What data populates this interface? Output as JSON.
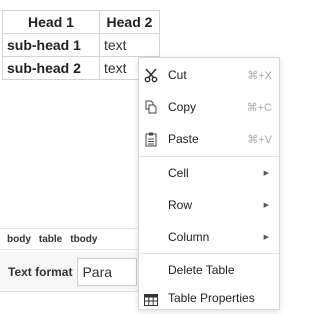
{
  "table": {
    "head1": "Head 1",
    "head2": "Head 2",
    "rows": [
      {
        "label": "sub-head 1",
        "value": "text"
      },
      {
        "label": "sub-head 2",
        "value": "text"
      }
    ]
  },
  "pathbar": {
    "items": [
      "body",
      "table",
      "tbody"
    ]
  },
  "format": {
    "label": "Text format",
    "value": "Para"
  },
  "context_menu": {
    "cut": {
      "label": "Cut",
      "shortcut": "⌘+X",
      "icon": "scissors-icon"
    },
    "copy": {
      "label": "Copy",
      "shortcut": "⌘+C",
      "icon": "copy-icon"
    },
    "paste": {
      "label": "Paste",
      "shortcut": "⌘+V",
      "icon": "clipboard-icon"
    },
    "cell": {
      "label": "Cell"
    },
    "row": {
      "label": "Row"
    },
    "column": {
      "label": "Column"
    },
    "delete_table": {
      "label": "Delete Table"
    },
    "table_properties": {
      "label": "Table Properties",
      "icon": "table-icon"
    }
  }
}
